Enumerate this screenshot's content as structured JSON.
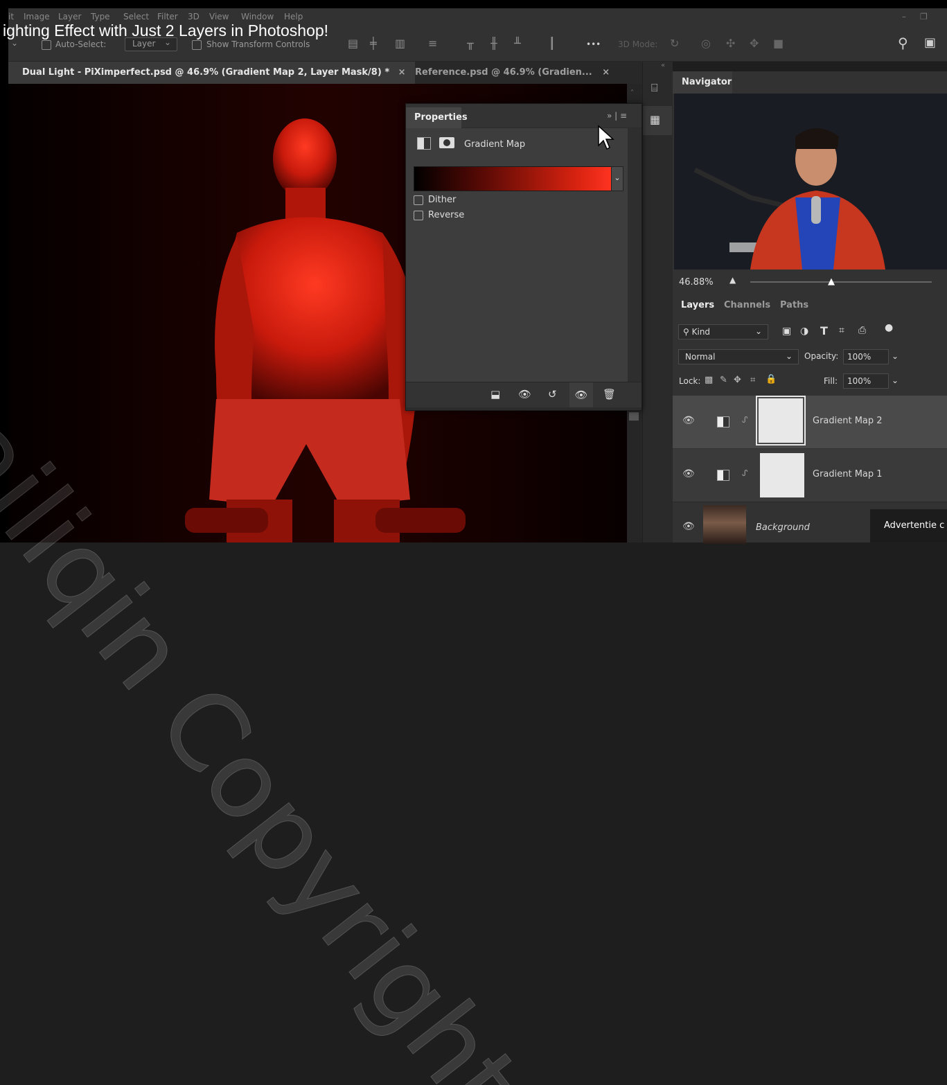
{
  "video_title": "ighting Effect with Just 2 Layers in Photoshop!",
  "menu": [
    "it",
    "Image",
    "Layer",
    "Type",
    "Select",
    "Filter",
    "3D",
    "View",
    "Window",
    "Help"
  ],
  "options": {
    "auto_select_label": "Auto-Select:",
    "auto_select_value": "Layer",
    "show_transform_label": "Show Transform Controls",
    "more": "•••",
    "mode_3d_label": "3D Mode:"
  },
  "tabs": [
    {
      "label": "Dual Light - PiXimperfect.psd @ 46.9% (Gradient Map 2, Layer Mask/8) *",
      "close": "×"
    },
    {
      "label": "Reference.psd @ 46.9% (Gradien...",
      "close": "×"
    }
  ],
  "properties": {
    "tab_label": "Properties",
    "header_icons": "»  |  ≡",
    "type_label": "Gradient Map",
    "gradient": {
      "from": "#000000",
      "to": "#ff2a1a"
    },
    "dither_label": "Dither",
    "reverse_label": "Reverse"
  },
  "navigator": {
    "tab_label": "Navigator",
    "zoom": "46.88%"
  },
  "layers_panel": {
    "tabs": [
      "Layers",
      "Channels",
      "Paths"
    ],
    "filter_label": "Kind",
    "blend_mode": "Normal",
    "opacity_label": "Opacity:",
    "opacity_value": "100%",
    "lock_label": "Lock:",
    "fill_label": "Fill:",
    "fill_value": "100%",
    "layers": [
      {
        "name": "Gradient Map 2",
        "selected": true
      },
      {
        "name": "Gradient Map 1",
        "selected": false
      },
      {
        "name": "Background",
        "selected": false
      }
    ]
  },
  "watermark": "Mailiqin Copyright",
  "ad_badge": "Advertentie c",
  "colors": {
    "accent_red": "#e0200f",
    "panel": "#323232",
    "canvas": "#0d0000"
  }
}
